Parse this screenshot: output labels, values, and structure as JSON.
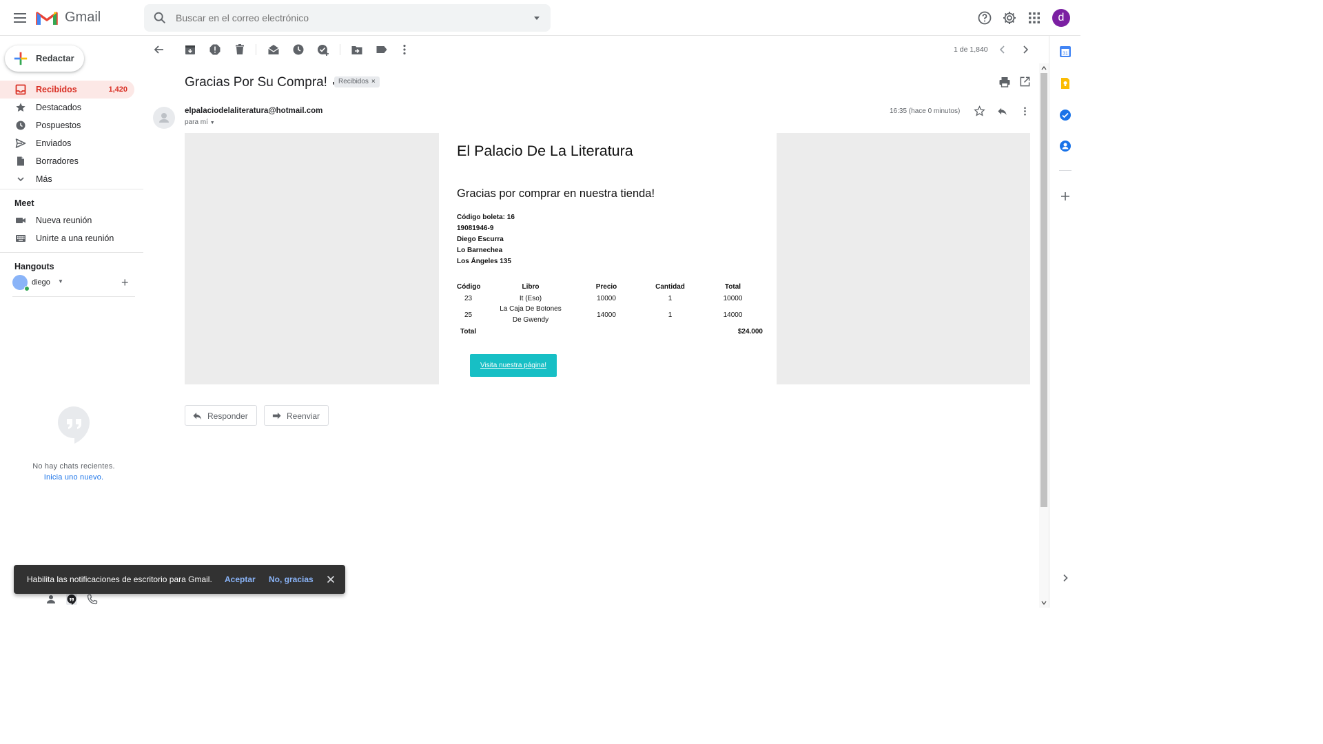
{
  "header": {
    "app_name": "Gmail",
    "search_placeholder": "Buscar en el correo electrónico",
    "avatar_letter": "d"
  },
  "sidebar": {
    "compose_label": "Redactar",
    "items": [
      {
        "label": "Recibidos",
        "count": "1,420",
        "icon": "inbox-icon"
      },
      {
        "label": "Destacados",
        "count": "",
        "icon": "star-icon"
      },
      {
        "label": "Pospuestos",
        "count": "",
        "icon": "clock-icon"
      },
      {
        "label": "Enviados",
        "count": "",
        "icon": "send-icon"
      },
      {
        "label": "Borradores",
        "count": "",
        "icon": "draft-icon"
      },
      {
        "label": "Más",
        "count": "",
        "icon": "chevron-down-icon"
      }
    ],
    "meet": {
      "title": "Meet",
      "new_meeting": "Nueva reunión",
      "join_meeting": "Unirte a una reunión"
    },
    "hangouts": {
      "title": "Hangouts",
      "user": "diego",
      "empty_text": "No hay chats recientes.",
      "empty_link": "Inicia uno nuevo."
    }
  },
  "toolbar": {
    "pager": "1 de 1,840"
  },
  "message": {
    "subject": "Gracias Por Su Compra! ✓",
    "label": "Recibidos",
    "sender": "elpalaciodelaliteratura@hotmail.com",
    "to": "para mí",
    "time": "16:35 (hace 0 minutos)"
  },
  "email_body": {
    "store_title": "El Palacio De La Literatura",
    "thanks": "Gracias por comprar en nuestra tienda!",
    "info": [
      "Código boleta: 16",
      "19081946-9",
      "Diego Escurra",
      "Lo Barnechea",
      "Los Ángeles 135"
    ],
    "table": {
      "headers": [
        "Código",
        "Libro",
        "Precio",
        "Cantidad",
        "Total"
      ],
      "rows": [
        {
          "code": "23",
          "book": "It (Eso)",
          "price": "10000",
          "qty": "1",
          "total": "10000"
        },
        {
          "code": "25",
          "book": "La Caja De Botones De Gwendy",
          "price": "14000",
          "qty": "1",
          "total": "14000"
        }
      ],
      "total_label": "Total",
      "total_value": "$24.000"
    },
    "visit_button": "Visita nuestra página!"
  },
  "actions": {
    "reply": "Responder",
    "forward": "Reenviar"
  },
  "snackbar": {
    "text": "Habilita las notificaciones de escritorio para Gmail.",
    "accept": "Aceptar",
    "decline": "No, gracias"
  },
  "colors": {
    "accent_red": "#d93025",
    "button_teal": "#17bfc5",
    "link_blue": "#1a73e8"
  }
}
